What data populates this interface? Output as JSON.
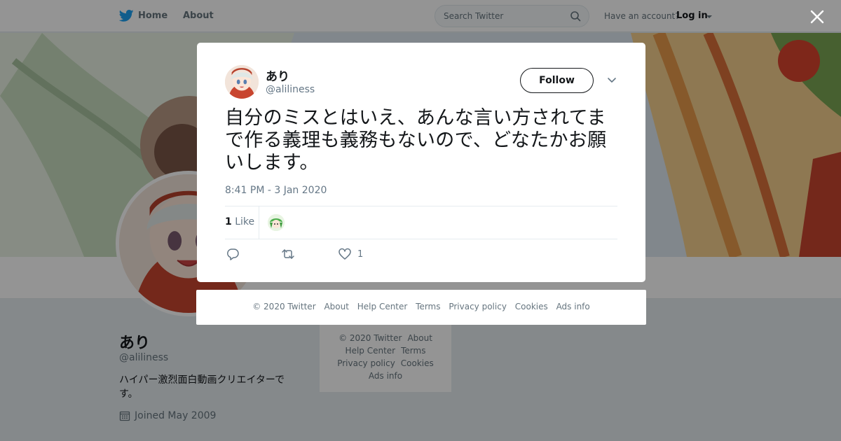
{
  "topbar": {
    "home_label": "Home",
    "about_label": "About",
    "search_placeholder": "Search Twitter",
    "account_prompt": "Have an account?",
    "login_label": "Log in"
  },
  "profile": {
    "name": "あり",
    "handle": "@aliliness",
    "bio": "ハイパー激烈面白動画クリエイターです。",
    "joined": "Joined May 2009"
  },
  "side_footer": {
    "copyright": "© 2020 Twitter",
    "about": "About",
    "help": "Help Center",
    "terms": "Terms",
    "privacy": "Privacy policy",
    "cookies": "Cookies",
    "ads": "Ads info"
  },
  "tweet": {
    "author_name": "あり",
    "author_handle": "@aliliness",
    "follow_label": "Follow",
    "text": "自分のミスとはいえ、あんな言い方されてまで作る義理も義務もないので、どなたかお願いします。",
    "timestamp": "8:41 PM - 3 Jan 2020",
    "like_count_stat": "1",
    "like_label": "Like",
    "like_count_action": "1"
  },
  "modal_footer": {
    "copyright": "© 2020 Twitter",
    "about": "About",
    "help": "Help Center",
    "terms": "Terms",
    "privacy": "Privacy policy",
    "cookies": "Cookies",
    "ads": "Ads info"
  },
  "colors": {
    "twitter_blue": "#1da1f2",
    "text_primary": "#14171a",
    "text_secondary": "#657786"
  },
  "icons": [
    "twitter-bird-icon",
    "search-icon",
    "caret-down-icon",
    "close-icon",
    "calendar-icon",
    "reply-icon",
    "retweet-icon",
    "heart-icon",
    "chevron-down-icon"
  ]
}
